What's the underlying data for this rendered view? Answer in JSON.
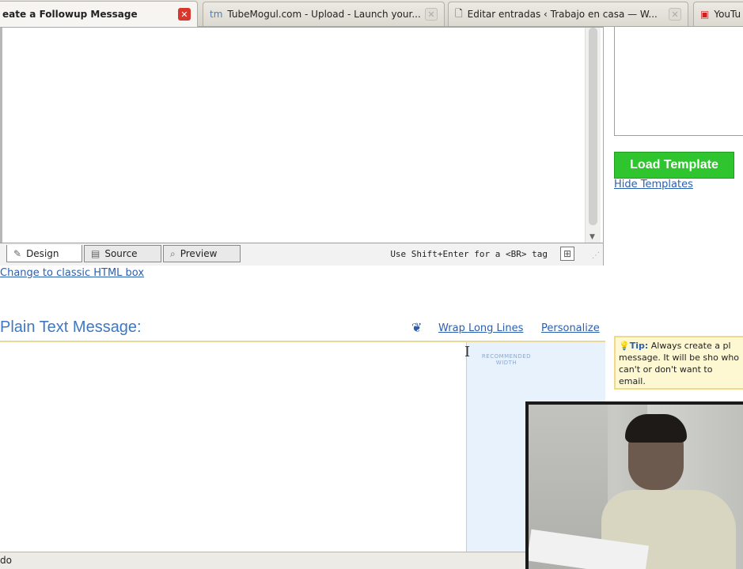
{
  "browser": {
    "tabs": [
      {
        "title": "eate a Followup Message",
        "favicon": "page-icon",
        "active": true
      },
      {
        "title": "TubeMogul.com - Upload - Launch your...",
        "favicon": "tm"
      },
      {
        "title": "Editar entradas ‹ Trabajo en casa — W...",
        "favicon": "document-icon"
      },
      {
        "title": "YouTu",
        "favicon": "youtube-icon"
      }
    ]
  },
  "editor": {
    "tabs": [
      {
        "label": "Design",
        "icon": "pencil-icon"
      },
      {
        "label": "Source",
        "icon": "code-icon"
      },
      {
        "label": "Preview",
        "icon": "magnifier-icon"
      }
    ],
    "shift_hint": "Use Shift+Enter for a <BR> tag",
    "classic_link": "Change to classic HTML box"
  },
  "templates": {
    "load_button": "Load Template",
    "hide_link": "Hide Templates"
  },
  "plain_text": {
    "title": "Plain Text Message:",
    "wrap_link": "Wrap Long Lines",
    "personalize_link": "Personalize",
    "recommended_label": "RECOMMENDED WIDTH"
  },
  "tip": {
    "label": "Tip:",
    "text": "Always create a pl message. It will be sho who can't or don't want to email."
  },
  "status": {
    "text": "do"
  },
  "colors": {
    "accent": "#2a5fb0",
    "load_button": "#2fc52f",
    "title_blue": "#3d78c4",
    "tip_bg": "#fdf8d2"
  }
}
